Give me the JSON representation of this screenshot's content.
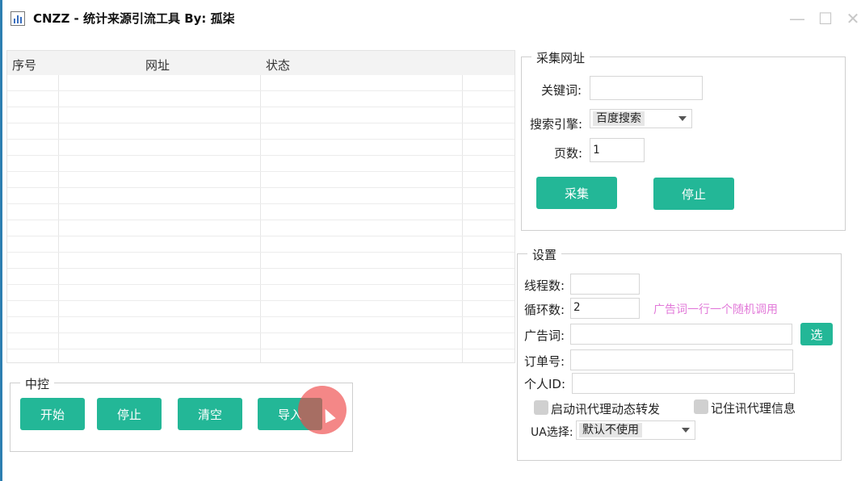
{
  "window": {
    "title": "CNZZ - 统计来源引流工具 By: 孤柒",
    "icon": "bar-chart-icon",
    "controls": [
      "minimize-icon",
      "maximize-icon",
      "close-icon"
    ]
  },
  "table": {
    "columns": [
      "序号",
      "网址",
      "状态"
    ],
    "rows": []
  },
  "collect": {
    "title": "采集网址",
    "keyword_label": "关键词:",
    "keyword_value": "",
    "engine_label": "搜索引擎:",
    "engine_value": "百度搜索",
    "pages_label": "页数:",
    "pages_value": "1",
    "collect_btn": "采集",
    "stop_btn": "停止"
  },
  "control": {
    "title": "中控",
    "start_btn": "开始",
    "stop_btn": "停止",
    "clear_btn": "清空",
    "import_btn": "导入"
  },
  "settings": {
    "title": "设置",
    "threads_label": "线程数:",
    "threads_value": "",
    "loops_label": "循环数:",
    "loops_value": "2",
    "hint": "广告词一行一个随机调用",
    "ad_label": "广告词:",
    "ad_value": "",
    "select_btn": "选择",
    "order_label": "订单号:",
    "order_value": "",
    "personal_label": "个人ID:",
    "personal_value": "",
    "proxy_check": "启动讯代理动态转发",
    "remember_check": "记住讯代理信息",
    "ua_label": "UA选择:",
    "ua_value": "默认不使用"
  },
  "colors": {
    "accent": "#23b797",
    "hint": "#e27ad9",
    "cursor_highlight": "#ee4646"
  }
}
